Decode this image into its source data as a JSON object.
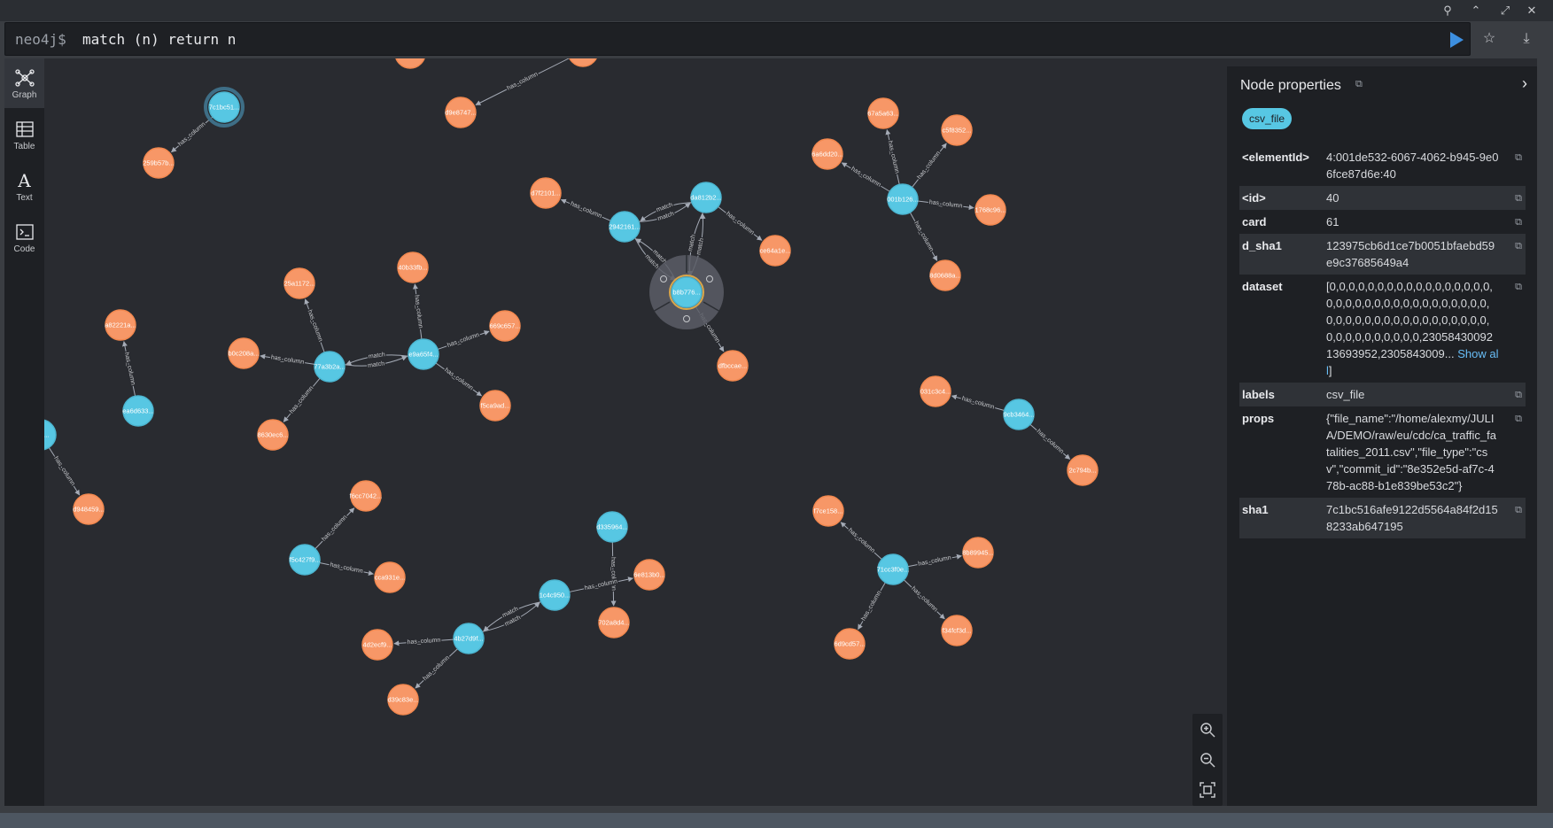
{
  "window": {
    "controls": [
      "pin-icon",
      "chevron-up-icon",
      "minimize-icon",
      "close-icon"
    ]
  },
  "editor": {
    "prompt": "neo4j$",
    "query": "match (n) return n"
  },
  "rail": [
    {
      "label": "Graph",
      "icon": "graph-icon",
      "active": true
    },
    {
      "label": "Table",
      "icon": "table-icon"
    },
    {
      "label": "Text",
      "icon": "text-icon"
    },
    {
      "label": "Code",
      "icon": "code-icon"
    }
  ],
  "colors": {
    "node_blue": "#57c7e3",
    "node_orange": "#f79767",
    "relationship": "#a5abb6",
    "canvas": "#292b30"
  },
  "graph": {
    "nodes": [
      {
        "id": "n1",
        "label": "7c1bc51...",
        "color": "blue",
        "selected": true
      },
      {
        "id": "n2",
        "label": "259b57b...",
        "color": "orange"
      },
      {
        "id": "n3",
        "label": "d9e8747...",
        "color": "orange"
      },
      {
        "id": "n4",
        "label": "e1b83c5...",
        "color": "orange"
      },
      {
        "id": "n5",
        "label": "",
        "color": "orange"
      },
      {
        "id": "n6",
        "label": "a82221a...",
        "color": "orange"
      },
      {
        "id": "n7",
        "label": "ea6d633...",
        "color": "blue"
      },
      {
        "id": "n8",
        "label": "25a1172...",
        "color": "orange"
      },
      {
        "id": "n9",
        "label": "b0c208a...",
        "color": "orange"
      },
      {
        "id": "n10",
        "label": "77a3b2a...",
        "color": "blue"
      },
      {
        "id": "n11",
        "label": "8630ec6...",
        "color": "orange"
      },
      {
        "id": "n12",
        "label": "40b33fb...",
        "color": "orange"
      },
      {
        "id": "n13",
        "label": "e9a65f4...",
        "color": "blue"
      },
      {
        "id": "n14",
        "label": "669c657...",
        "color": "orange"
      },
      {
        "id": "n15",
        "label": "f5ca9ad...",
        "color": "orange"
      },
      {
        "id": "n16",
        "label": "d7f2101...",
        "color": "orange"
      },
      {
        "id": "n17",
        "label": "2942161...",
        "color": "blue"
      },
      {
        "id": "n18",
        "label": "da812b2...",
        "color": "blue"
      },
      {
        "id": "n19",
        "label": "ce64a1e...",
        "color": "orange"
      },
      {
        "id": "n20",
        "label": "b8b776...",
        "color": "blue",
        "ring": true
      },
      {
        "id": "n21",
        "label": "dfbccae...",
        "color": "orange"
      },
      {
        "id": "n22",
        "label": "67a5a63...",
        "color": "orange"
      },
      {
        "id": "n23",
        "label": "c5f8352...",
        "color": "orange"
      },
      {
        "id": "n24",
        "label": "6a6dd20...",
        "color": "orange"
      },
      {
        "id": "n25",
        "label": "001b126...",
        "color": "blue"
      },
      {
        "id": "n26",
        "label": "1768c96...",
        "color": "orange"
      },
      {
        "id": "n27",
        "label": "8d0688a...",
        "color": "orange"
      },
      {
        "id": "n28",
        "label": "031c3c4...",
        "color": "orange"
      },
      {
        "id": "n29",
        "label": "9cb3464...",
        "color": "blue"
      },
      {
        "id": "n30",
        "label": "2c794b...",
        "color": "orange"
      },
      {
        "id": "n31",
        "label": "59d...",
        "color": "blue"
      },
      {
        "id": "n32",
        "label": "d948459...",
        "color": "orange"
      },
      {
        "id": "n33",
        "label": "f6cc7042...",
        "color": "orange"
      },
      {
        "id": "n34",
        "label": "f5c427f9...",
        "color": "blue"
      },
      {
        "id": "n35",
        "label": "cca931e...",
        "color": "orange"
      },
      {
        "id": "n36",
        "label": "d335964...",
        "color": "blue"
      },
      {
        "id": "n37",
        "label": "1c4c950...",
        "color": "blue"
      },
      {
        "id": "n38",
        "label": "6e813b0...",
        "color": "orange"
      },
      {
        "id": "n39",
        "label": "702a8d4...",
        "color": "orange"
      },
      {
        "id": "n40",
        "label": "4b27d9f...",
        "color": "blue"
      },
      {
        "id": "n41",
        "label": "4d2ecf9...",
        "color": "orange"
      },
      {
        "id": "n42",
        "label": "d39c83e...",
        "color": "orange"
      },
      {
        "id": "n43",
        "label": "f7ce158...",
        "color": "orange"
      },
      {
        "id": "n44",
        "label": "71cc3f0e...",
        "color": "blue"
      },
      {
        "id": "n45",
        "label": "8b89945...",
        "color": "orange"
      },
      {
        "id": "n46",
        "label": "6d9cd57...",
        "color": "orange"
      },
      {
        "id": "n47",
        "label": "f34fcf3d...",
        "color": "orange"
      }
    ],
    "edges": [
      {
        "from": "n1",
        "to": "n2",
        "label": "has_column"
      },
      {
        "from": "n5",
        "to": "n3",
        "label": "has_column"
      },
      {
        "from": "n7",
        "to": "n6",
        "label": "has_column"
      },
      {
        "from": "n10",
        "to": "n8",
        "label": "has_column"
      },
      {
        "from": "n10",
        "to": "n9",
        "label": "has_column"
      },
      {
        "from": "n10",
        "to": "n11",
        "label": "has_column"
      },
      {
        "from": "n10",
        "to": "n13",
        "label": "match"
      },
      {
        "from": "n13",
        "to": "n10",
        "label": "match"
      },
      {
        "from": "n13",
        "to": "n12",
        "label": "has_column"
      },
      {
        "from": "n13",
        "to": "n14",
        "label": "has_column"
      },
      {
        "from": "n13",
        "to": "n15",
        "label": "has_column"
      },
      {
        "from": "n17",
        "to": "n16",
        "label": "has_column"
      },
      {
        "from": "n17",
        "to": "n18",
        "label": "match"
      },
      {
        "from": "n18",
        "to": "n17",
        "label": "match"
      },
      {
        "from": "n18",
        "to": "n19",
        "label": "has_column"
      },
      {
        "from": "n20",
        "to": "n17",
        "label": "match"
      },
      {
        "from": "n17",
        "to": "n20",
        "label": "match"
      },
      {
        "from": "n20",
        "to": "n18",
        "label": "match"
      },
      {
        "from": "n18",
        "to": "n20",
        "label": "match"
      },
      {
        "from": "n20",
        "to": "n21",
        "label": "has_column"
      },
      {
        "from": "n25",
        "to": "n22",
        "label": "has_column"
      },
      {
        "from": "n25",
        "to": "n23",
        "label": "has_column"
      },
      {
        "from": "n25",
        "to": "n24",
        "label": "has_column"
      },
      {
        "from": "n25",
        "to": "n26",
        "label": "has_column"
      },
      {
        "from": "n25",
        "to": "n27",
        "label": "has_column"
      },
      {
        "from": "n29",
        "to": "n28",
        "label": "has_column"
      },
      {
        "from": "n29",
        "to": "n30",
        "label": "has_column"
      },
      {
        "from": "n31",
        "to": "n32",
        "label": "has_column"
      },
      {
        "from": "n34",
        "to": "n33",
        "label": "has_column"
      },
      {
        "from": "n34",
        "to": "n35",
        "label": "has_column"
      },
      {
        "from": "n36",
        "to": "n39",
        "label": "has_column"
      },
      {
        "from": "n37",
        "to": "n38",
        "label": "has_column"
      },
      {
        "from": "n40",
        "to": "n37",
        "label": "match"
      },
      {
        "from": "n37",
        "to": "n40",
        "label": "match"
      },
      {
        "from": "n40",
        "to": "n41",
        "label": "has_column"
      },
      {
        "from": "n40",
        "to": "n42",
        "label": "has_column"
      },
      {
        "from": "n44",
        "to": "n43",
        "label": "has_column"
      },
      {
        "from": "n44",
        "to": "n45",
        "label": "has_column"
      },
      {
        "from": "n44",
        "to": "n46",
        "label": "has_column"
      },
      {
        "from": "n44",
        "to": "n47",
        "label": "has_column"
      }
    ]
  },
  "zoom": [
    "zoom-in-icon",
    "zoom-out-icon",
    "fit-icon"
  ],
  "props_panel": {
    "title": "Node properties",
    "label_chip": "csv_file",
    "rows": [
      {
        "key": "<elementId>",
        "value": "4:001de532-6067-4062-b945-9e06fce87d6e:40"
      },
      {
        "key": "<id>",
        "value": "40"
      },
      {
        "key": "card",
        "value": "61"
      },
      {
        "key": "d_sha1",
        "value": "123975cb6d1ce7b0051bfaebd59e9c37685649a4"
      },
      {
        "key": "dataset",
        "value": "[0,0,0,0,0,0,0,0,0,0,0,0,0,0,0,0,0,0,0,0,0,0,0,0,0,0,0,0,0,0,0,0,0,0,0,0,0,0,0,0,0,0,0,0,0,0,0,0,0,0,0,0,0,0,0,0,0,0,0,0,0,2305843009213693952,2305843009...",
        "show_all": "Show all",
        "suffix": "]"
      },
      {
        "key": "labels",
        "value": "csv_file"
      },
      {
        "key": "props",
        "value": "{\"file_name\":\"/home/alexmy/JULIA/DEMO/raw/eu/cdc/ca_traffic_fatalities_2011.csv\",\"file_type\":\"csv\",\"commit_id\":\"8e352e5d-af7c-478b-ac88-b1e839be53c2\"}"
      },
      {
        "key": "sha1",
        "value": "7c1bc516afe9122d5564a84f2d158233ab647195"
      }
    ]
  }
}
